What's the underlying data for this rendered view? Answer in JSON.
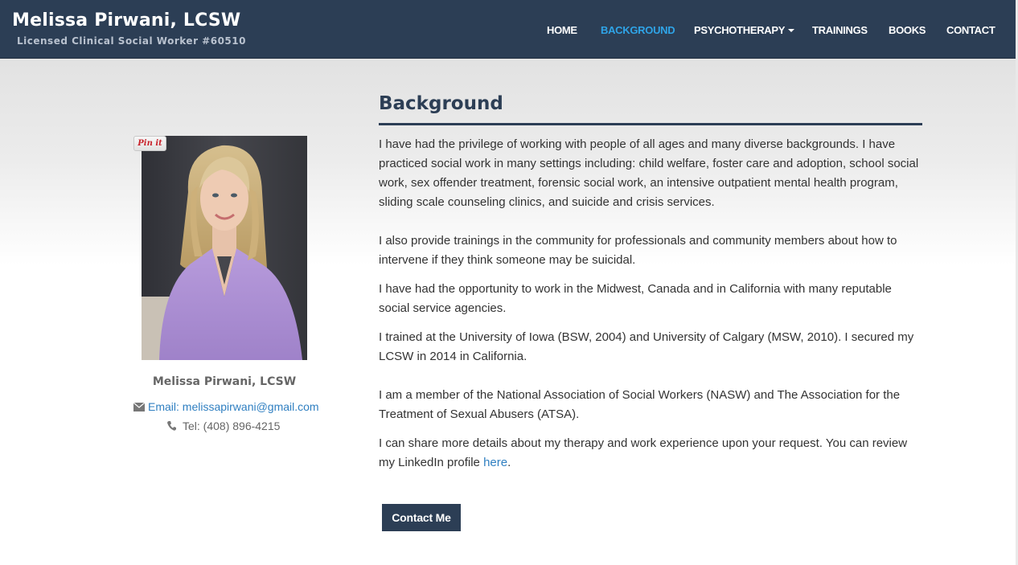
{
  "brand": {
    "title": "Melissa Pirwani, LCSW",
    "subtitle": "Licensed Clinical Social Worker #60510"
  },
  "nav": {
    "items": [
      {
        "label": "HOME"
      },
      {
        "label": "BACKGROUND",
        "active": true
      },
      {
        "label": "PSYCHOTHERAPY",
        "dropdown": true
      },
      {
        "label": "TRAININGS"
      },
      {
        "label": "BOOKS"
      },
      {
        "label": "CONTACT"
      }
    ]
  },
  "profile": {
    "pin_label": "Pin it",
    "name": "Melissa Pirwani, LCSW",
    "email": "Email: melissapirwani@gmail.com",
    "tel": "Tel: (408) 896-4215"
  },
  "main": {
    "heading": "Background",
    "paragraphs": [
      "I have had the privilege of working with people of all ages and many diverse backgrounds. I have practiced social work in many settings including: child welfare, foster care and adoption, school social work, sex offender treatment, forensic social work, an intensive outpatient mental health program, sliding scale counseling clinics, and suicide and crisis services.",
      "I also provide trainings in the community for professionals and community members about how to intervene if they think someone may be suicidal.",
      "I have had the opportunity to work in the Midwest, Canada and in California with many reputable social service agencies.",
      "I trained at the University of Iowa (BSW, 2004) and University of Calgary (MSW, 2010). I secured my LCSW in 2014 in California.",
      "I am a member of the National Association of Social Workers (NASW) and The Association for the Treatment of Sexual Abusers (ATSA).",
      "I can share more details about my therapy and work experience upon your request. You can review my LinkedIn profile"
    ],
    "linkedin_link": "here",
    "period": ".",
    "contact_button": "Contact Me"
  },
  "colors": {
    "navbar": "#2c3e55",
    "active_nav": "#2fa4e7",
    "link": "#2f7fc1"
  },
  "icons": {
    "email": "envelope-icon",
    "tel": "phone-icon"
  }
}
